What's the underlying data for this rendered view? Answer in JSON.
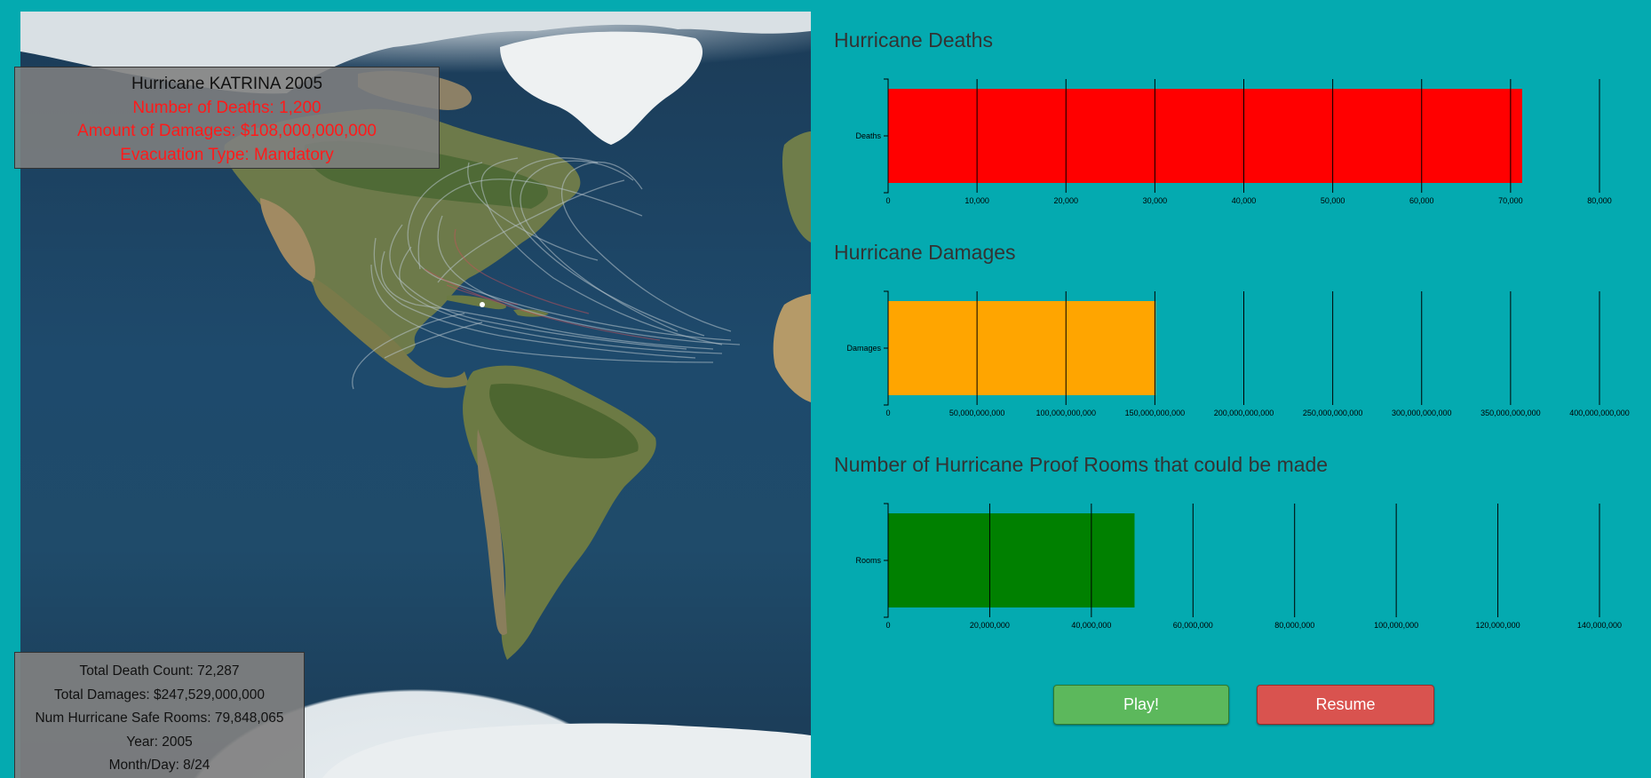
{
  "current_hurricane": {
    "title": "Hurricane KATRINA 2005",
    "deaths": "Number of Deaths: 1,200",
    "damages": "Amount of Damages: $108,000,000,000",
    "evacuation": "Evacuation Type: Mandatory"
  },
  "totals": {
    "deaths": "Total Death Count: 72,287",
    "damages": "Total Damages: $247,529,000,000",
    "rooms": "Num Hurricane Safe Rooms: 79,848,065",
    "year": "Year: 2005",
    "month_day": "Month/Day: 8/24"
  },
  "buttons": {
    "play": "Play!",
    "resume": "Resume"
  },
  "colors": {
    "background": "#04aab0",
    "deaths_bar": "#ff0000",
    "damages_bar": "#ffa500",
    "rooms_bar": "#008000",
    "play_button": "#5cb85c",
    "resume_button": "#d9534f"
  },
  "chart_data": [
    {
      "type": "bar",
      "title": "Hurricane Deaths",
      "categories": [
        "Deaths"
      ],
      "values": [
        71300
      ],
      "xlim": [
        0,
        80000
      ],
      "tick_values": [
        0,
        10000,
        20000,
        30000,
        40000,
        50000,
        60000,
        70000,
        80000
      ],
      "tick_labels": [
        "0",
        "10,000",
        "20,000",
        "30,000",
        "40,000",
        "50,000",
        "60,000",
        "70,000",
        "80,000"
      ],
      "color": "#ff0000",
      "grid": true
    },
    {
      "type": "bar",
      "title": "Hurricane Damages",
      "categories": [
        "Damages"
      ],
      "values": [
        150500000000
      ],
      "xlim": [
        0,
        400000000000
      ],
      "tick_values": [
        0,
        50000000000,
        100000000000,
        150000000000,
        200000000000,
        250000000000,
        300000000000,
        350000000000,
        400000000000
      ],
      "tick_labels": [
        "0",
        "50,000,000,000",
        "100,000,000,000",
        "150,000,000,000",
        "200,000,000,000",
        "250,000,000,000",
        "300,000,000,000",
        "350,000,000,000",
        "400,000,000,000"
      ],
      "color": "#ffa500",
      "grid": true
    },
    {
      "type": "bar",
      "title": "Number of Hurricane Proof Rooms that could be made",
      "categories": [
        "Rooms"
      ],
      "values": [
        48500000
      ],
      "xlim": [
        0,
        140000000
      ],
      "tick_values": [
        0,
        20000000,
        40000000,
        60000000,
        80000000,
        100000000,
        120000000,
        140000000
      ],
      "tick_labels": [
        "0",
        "20,000,000",
        "40,000,000",
        "60,000,000",
        "80,000,000",
        "100,000,000",
        "120,000,000",
        "140,000,000"
      ],
      "color": "#008000",
      "grid": true
    }
  ]
}
